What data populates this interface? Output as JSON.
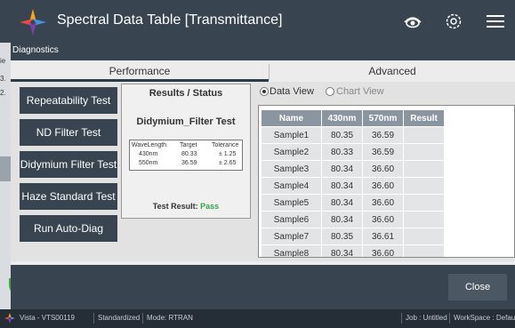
{
  "app": {
    "title": "Spectral Data Table [Transmittance]"
  },
  "background": {
    "strip_lines": [
      "ie",
      "3.",
      "2."
    ]
  },
  "dialog": {
    "title": "Diagnostics",
    "tabs": [
      {
        "label": "Performance",
        "active": true
      },
      {
        "label": "Advanced",
        "active": false
      }
    ],
    "tests": [
      "Repeatability Test",
      "ND Filter Test",
      "Didymium Filter Test",
      "Haze Standard Test",
      "Run Auto-Diag"
    ],
    "status": {
      "header": "Results / Status",
      "test_name": "Didymium_Filter Test",
      "spec_table": {
        "columns": [
          "WaveLength",
          "Target",
          "Tolerance"
        ],
        "rows": [
          [
            "430nm",
            "80.33",
            "± 1.25"
          ],
          [
            "550nm",
            "36.59",
            "± 2.65"
          ]
        ]
      },
      "result_label": "Test Result:",
      "result_value": "Pass"
    },
    "view_options": [
      {
        "label": "Data View",
        "selected": true
      },
      {
        "label": "Chart View",
        "selected": false
      }
    ],
    "data_table": {
      "columns": [
        "Name",
        "430nm",
        "570nm",
        "Result"
      ],
      "rows": [
        [
          "Sample1",
          "80.35",
          "36.59",
          ""
        ],
        [
          "Sample2",
          "80.33",
          "36.59",
          ""
        ],
        [
          "Sample3",
          "80.34",
          "36.60",
          ""
        ],
        [
          "Sample4",
          "80.34",
          "36.60",
          ""
        ],
        [
          "Sample5",
          "80.34",
          "36.60",
          ""
        ],
        [
          "Sample6",
          "80.34",
          "36.60",
          ""
        ],
        [
          "Sample7",
          "80.35",
          "36.61",
          ""
        ],
        [
          "Sample8",
          "80.34",
          "36.60",
          ""
        ]
      ]
    },
    "close_label": "Close"
  },
  "statusbar": {
    "instrument": "Vista - VTS00119",
    "mode_standard": "Standardized",
    "mode": "Mode: RTRAN",
    "job": "Job : Untitled",
    "workspace": "WorkSpace : Defau"
  },
  "colors": {
    "titlebar": "#38444f",
    "button": "#38444f",
    "table_header": "#8a95a0",
    "pass": "#2fa84a"
  },
  "icons": [
    "app-logo-icon",
    "eye-icon",
    "gear-icon",
    "menu-icon",
    "status-logo-icon"
  ]
}
